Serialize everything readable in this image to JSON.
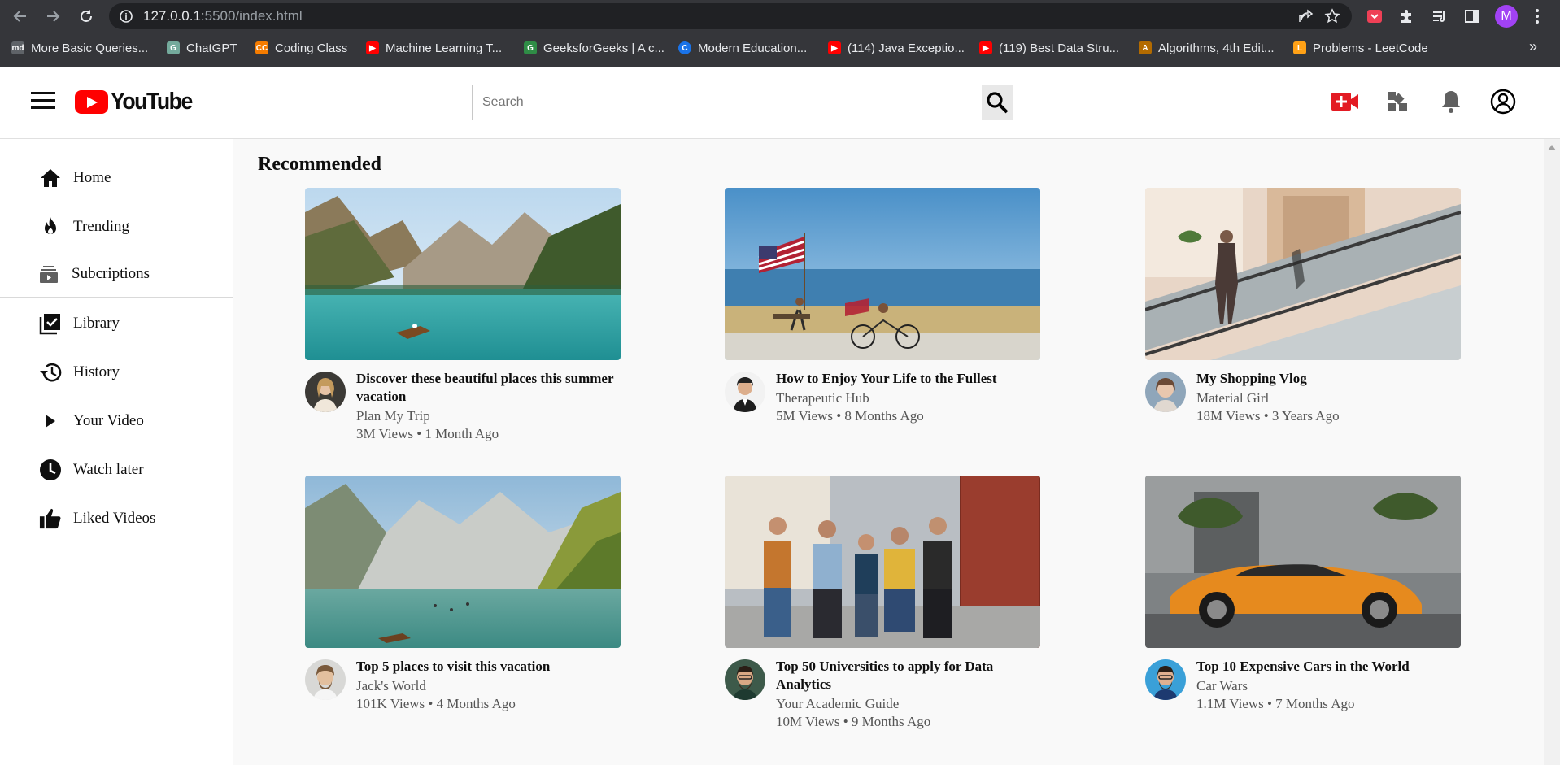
{
  "browser": {
    "url_host": "127.0.0.1:",
    "url_path": "5500/index.html",
    "profile_initial": "M",
    "bookmarks": [
      {
        "label": "More Basic Queries...",
        "icon_color": "#5f6368",
        "icon_text": "md"
      },
      {
        "label": "ChatGPT",
        "icon_color": "#74aa9c",
        "icon_text": "G"
      },
      {
        "label": "Coding Class",
        "icon_color": "#f57c00",
        "icon_text": "CC"
      },
      {
        "label": "Machine Learning T...",
        "icon_color": "#ff0000",
        "icon_text": "▶"
      },
      {
        "label": "GeeksforGeeks | A c...",
        "icon_color": "#2f8d46",
        "icon_text": "G"
      },
      {
        "label": "Modern Education...",
        "icon_color": "#1a73e8",
        "icon_text": "C"
      },
      {
        "label": "(114) Java Exceptio...",
        "icon_color": "#ff0000",
        "icon_text": "▶"
      },
      {
        "label": "(119) Best Data Stru...",
        "icon_color": "#ff0000",
        "icon_text": "▶"
      },
      {
        "label": "Algorithms, 4th Edit...",
        "icon_color": "#b36b00",
        "icon_text": "A"
      },
      {
        "label": "Problems - LeetCode",
        "icon_color": "#ffa116",
        "icon_text": "L"
      }
    ],
    "more_bookmarks": "»"
  },
  "header": {
    "logo_text": "YouTube",
    "search_placeholder": "Search",
    "brand_color": "#ff0000",
    "upload_icon_color": "#e31b23"
  },
  "sidebar": {
    "items": [
      {
        "label": "Home",
        "icon": "home-icon"
      },
      {
        "label": "Trending",
        "icon": "flame-icon"
      },
      {
        "label": "Subcriptions",
        "icon": "subscriptions-icon"
      },
      {
        "label": "Library",
        "icon": "library-icon"
      },
      {
        "label": "History",
        "icon": "history-icon"
      },
      {
        "label": "Your Video",
        "icon": "play-icon"
      },
      {
        "label": "Watch later",
        "icon": "clock-icon"
      },
      {
        "label": "Liked Videos",
        "icon": "thumbs-up-icon"
      }
    ]
  },
  "main": {
    "section_title": "Recommended",
    "videos": [
      {
        "title": "Discover these beautiful places this summer vacation",
        "channel": "Plan My Trip",
        "meta": "3M Views • 1 Month Ago",
        "thumb": "lake-mountains-boat"
      },
      {
        "title": "How to Enjoy Your Life to the Fullest",
        "channel": "Therapeutic Hub",
        "meta": "5M Views • 8 Months Ago",
        "thumb": "beach-flags-bicycle"
      },
      {
        "title": "My Shopping Vlog",
        "channel": "Material Girl",
        "meta": "18M Views • 3 Years Ago",
        "thumb": "mall-escalator"
      },
      {
        "title": "Top 5 places to visit this vacation",
        "channel": "Jack's World",
        "meta": "101K Views • 4 Months Ago",
        "thumb": "alpine-lake"
      },
      {
        "title": "Top 50 Universities to apply for Data Analytics",
        "channel": "Your Academic Guide",
        "meta": "10M Views • 9 Months Ago",
        "thumb": "students-walking"
      },
      {
        "title": "Top 10 Expensive Cars in the World",
        "channel": "Car Wars",
        "meta": "1.1M Views • 7 Months Ago",
        "thumb": "orange-sports-car"
      }
    ]
  }
}
